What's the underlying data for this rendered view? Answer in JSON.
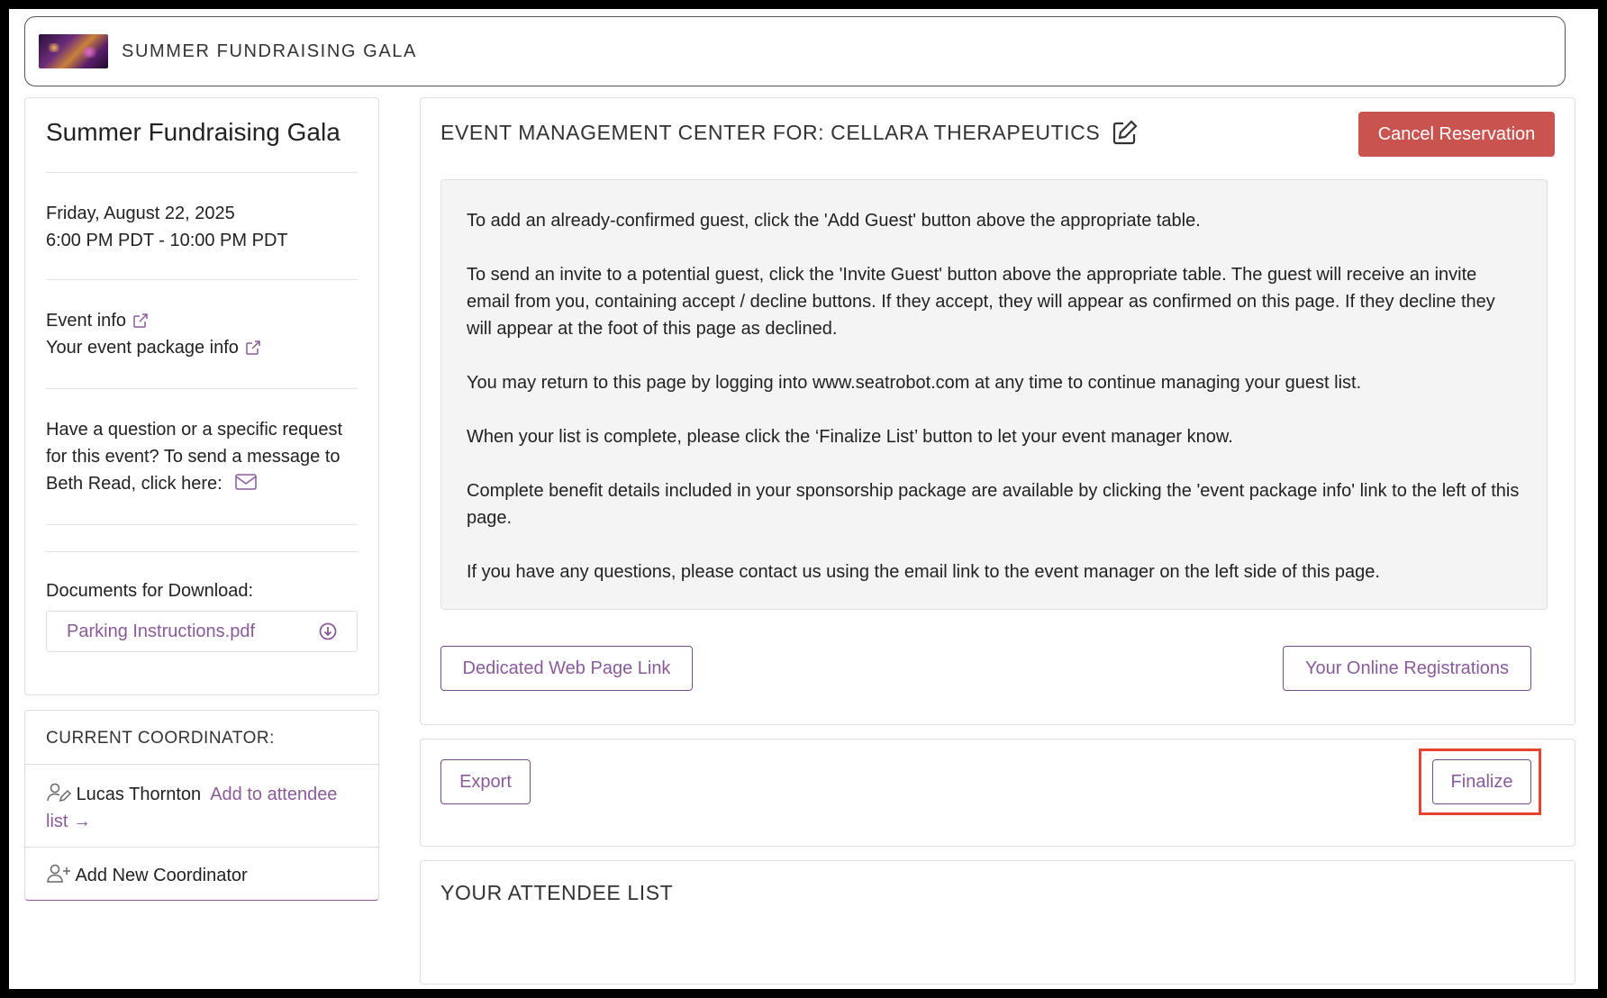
{
  "header": {
    "title": "SUMMER FUNDRAISING GALA"
  },
  "sidebar": {
    "event_name": "Summer Fundraising Gala",
    "date": "Friday, August 22, 2025",
    "time": "6:00 PM PDT - 10:00 PM PDT",
    "event_info_label": "Event info",
    "package_info_label": "Your event package info",
    "question_text": "Have a question or a specific request for this event? To send a message to Beth Read, click here:",
    "documents_label": "Documents for Download:",
    "documents": [
      {
        "name": "Parking Instructions.pdf"
      }
    ]
  },
  "coordinator": {
    "heading": "CURRENT COORDINATOR:",
    "name": "Lucas Thornton",
    "add_to_list_label": "Add to attendee list",
    "add_new_label": "Add New Coordinator"
  },
  "main": {
    "title": "EVENT MANAGEMENT CENTER FOR: CELLARA THERAPEUTICS",
    "cancel_label": "Cancel Reservation",
    "instructions": [
      "To add an already-confirmed guest, click the 'Add Guest' button above the appropriate table.",
      "To send an invite to a potential guest, click the 'Invite Guest' button above the appropriate table. The guest will receive an invite email from you, containing accept / decline buttons. If they accept, they will appear as confirmed on this page. If they decline they will appear at the foot of this page as declined.",
      "You may return to this page by logging into www.seatrobot.com at any time to continue managing your guest list.",
      "When your list is complete, please click the ‘Finalize List’ button to let your event manager know.",
      "Complete benefit details included in your sponsorship package are available by clicking the 'event package info' link to the left of this page.",
      "If you have any questions, please contact us using the email link to the event manager on the left side of this page."
    ],
    "web_page_link_label": "Dedicated Web Page Link",
    "registrations_label": "Your Online Registrations"
  },
  "actions": {
    "export_label": "Export",
    "finalize_label": "Finalize"
  },
  "attendees": {
    "title": "YOUR ATTENDEE LIST"
  },
  "colors": {
    "accent": "#8a5a9a",
    "danger": "#c9534f",
    "highlight": "#e8432f"
  }
}
